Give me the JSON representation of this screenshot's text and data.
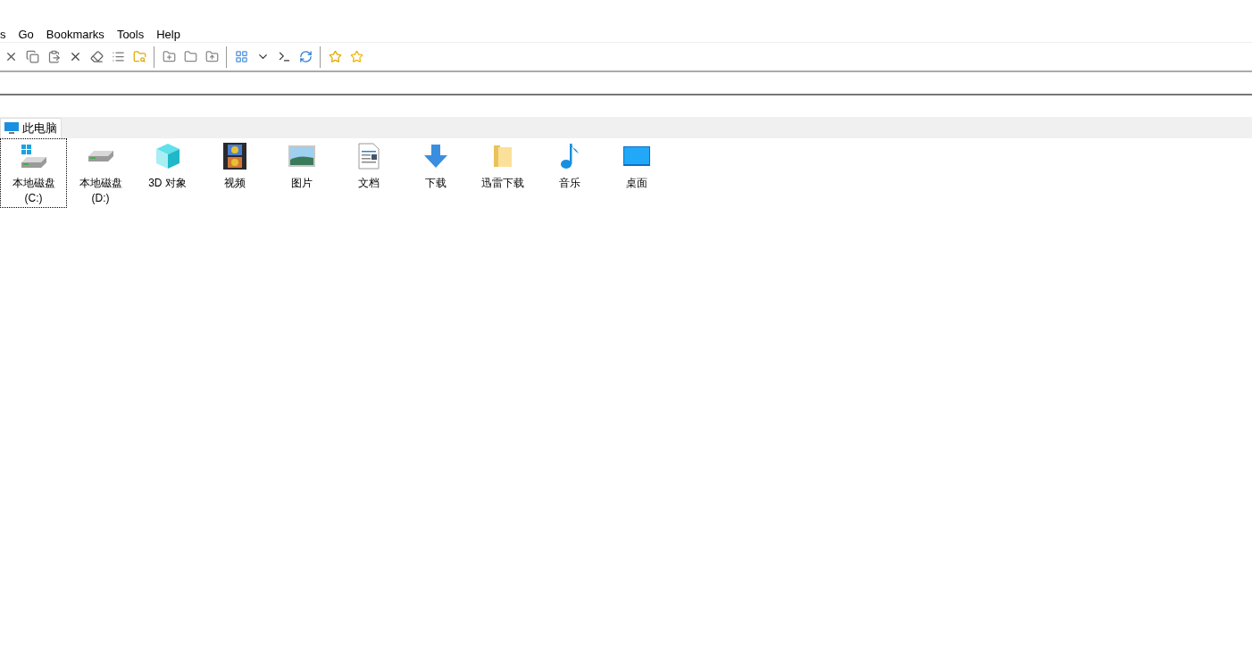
{
  "menu": [
    "s",
    "Go",
    "Bookmarks",
    "Tools",
    "Help"
  ],
  "tabs": [
    {
      "label": "此电脑",
      "selected": true
    }
  ],
  "items": [
    {
      "label": "本地磁盘 (C:)",
      "kind": "system-drive",
      "selected": true
    },
    {
      "label": "本地磁盘 (D:)",
      "kind": "drive",
      "selected": false
    },
    {
      "label": "3D 对象",
      "kind": "cube",
      "selected": false
    },
    {
      "label": "视频",
      "kind": "film",
      "selected": false
    },
    {
      "label": "图片",
      "kind": "picture",
      "selected": false
    },
    {
      "label": "文档",
      "kind": "document",
      "selected": false
    },
    {
      "label": "下载",
      "kind": "download",
      "selected": false
    },
    {
      "label": "迅雷下载",
      "kind": "folder",
      "selected": false
    },
    {
      "label": "音乐",
      "kind": "music",
      "selected": false
    },
    {
      "label": "桌面",
      "kind": "desktop",
      "selected": false
    }
  ]
}
